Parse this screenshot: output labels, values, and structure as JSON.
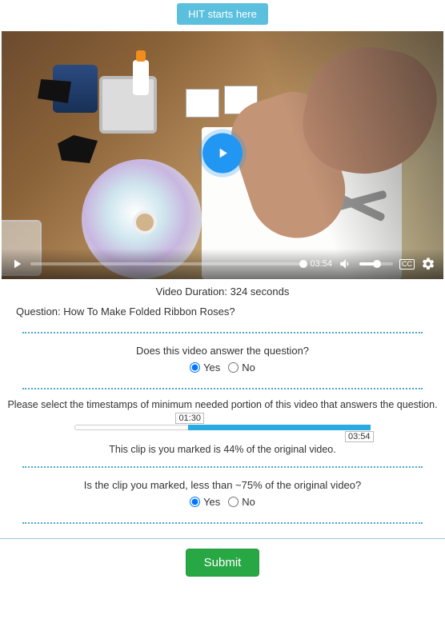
{
  "top_button": "HIT starts here",
  "video": {
    "current_time": "03:54",
    "cc_label": "CC"
  },
  "duration_label": "Video Duration: 324 seconds",
  "question_label": "Question: How To Make Folded Ribbon Roses?",
  "q1": {
    "prompt": "Does this video answer the question?",
    "yes": "Yes",
    "no": "No",
    "selected": "yes"
  },
  "timestamps": {
    "prompt": "Please select the timestamps of minimum needed portion of this video that answers the question.",
    "start": "01:30",
    "end": "03:54",
    "start_pct": 38.5,
    "end_pct": 100
  },
  "clip_pct_text": "This clip is you marked is 44% of the original video.",
  "q2": {
    "prompt": "Is the clip you marked, less than ~75% of the original video?",
    "yes": "Yes",
    "no": "No",
    "selected": "yes"
  },
  "submit_label": "Submit"
}
